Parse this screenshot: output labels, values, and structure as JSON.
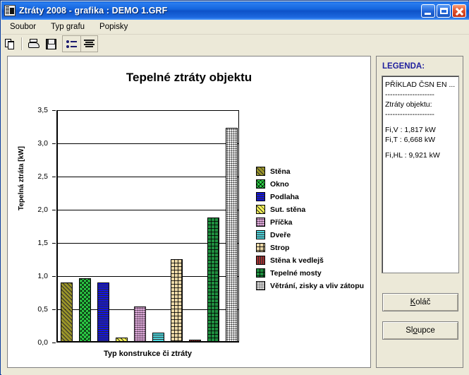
{
  "window": {
    "title": "Ztráty 2008 - grafika : DEMO 1.GRF",
    "icon": "app-icon",
    "buttons": {
      "minimize": "_",
      "maximize": "□",
      "close": "×"
    }
  },
  "menu": {
    "items": [
      "Soubor",
      "Typ grafu",
      "Popisky"
    ]
  },
  "toolbar": {
    "items": [
      {
        "name": "copy-icon",
        "tip": "Kopírovat"
      },
      {
        "name": "print-icon",
        "tip": "Tisk"
      },
      {
        "name": "save-icon",
        "tip": "Uložit"
      },
      {
        "name": "legend-list-icon",
        "tip": "Legenda"
      },
      {
        "name": "align-text-icon",
        "tip": "Popisky"
      }
    ]
  },
  "side": {
    "title": "LEGENDA:",
    "lines": [
      "PŘÍKLAD ČSN EN ...",
      "--------------------",
      "Ztráty objektu:",
      "--------------------",
      "",
      "Fi,V : 1,817 kW",
      "Fi,T : 6,668 kW",
      "",
      "Fi,HL : 9,921 kW"
    ],
    "buttons": {
      "pie": "Koláč",
      "pie_accel": "K",
      "bars": "Sloupce",
      "bars_accel": "o"
    }
  },
  "chart_data": {
    "type": "bar",
    "title": "Tepelné ztráty objektu",
    "xlabel": "Typ konstrukce či ztráty",
    "ylabel": "Tepelná ztráta [kW]",
    "ylim": [
      0,
      3.5
    ],
    "yticks": [
      "0,0",
      "0,5",
      "1,0",
      "1,5",
      "2,0",
      "2,5",
      "3,0",
      "3,5"
    ],
    "ytick_values": [
      0,
      0.5,
      1.0,
      1.5,
      2.0,
      2.5,
      3.0,
      3.5
    ],
    "grid": true,
    "legend_position": "right",
    "categories": [
      "Stěna",
      "Okno",
      "Podlaha",
      "Sut. stěna",
      "Příčka",
      "Dveře",
      "Strop",
      "Stěna k vedlejš",
      "Tepelné mosty",
      "Větrání, zisky a vliv zátopu"
    ],
    "values": [
      0.9,
      0.96,
      0.9,
      0.06,
      0.53,
      0.14,
      1.25,
      0.03,
      1.88,
      3.24
    ],
    "colors": [
      "#9a9428",
      "#2fd94a",
      "#1414e0",
      "#f3f055",
      "#edb4e8",
      "#4fd9e0",
      "#ecd9a8",
      "#a03030",
      "#1f8f3f",
      "#f2f2f2"
    ],
    "patterns": [
      "diagonal",
      "crosshatch",
      "horizontal",
      "diagonal",
      "dots",
      "horizontal",
      "grid",
      "vertical",
      "grid",
      "dots"
    ]
  }
}
